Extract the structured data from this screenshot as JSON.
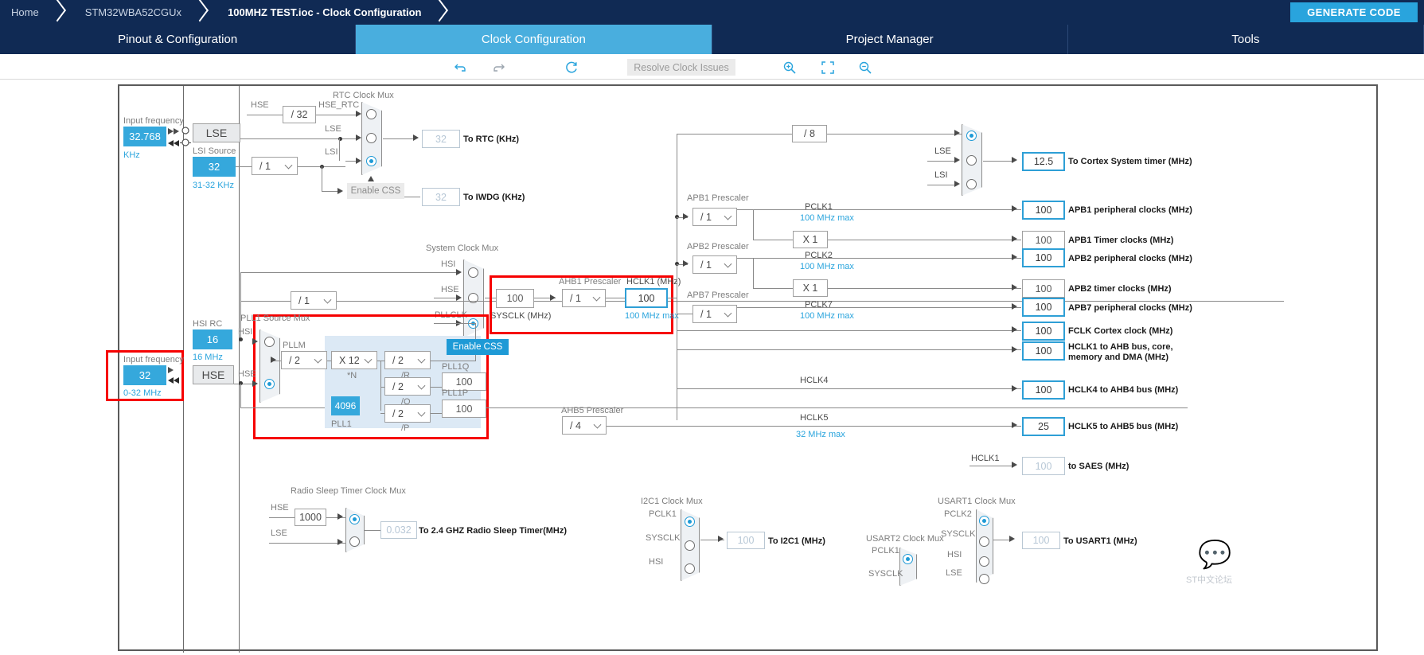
{
  "breadcrumb": {
    "items": [
      {
        "label": "Home",
        "active": false
      },
      {
        "label": "STM32WBA52CGUx",
        "active": false
      },
      {
        "label": "100MHZ TEST.ioc - Clock Configuration",
        "active": true
      }
    ],
    "generate_code_label": "GENERATE CODE"
  },
  "tabs": [
    {
      "label": "Pinout & Configuration",
      "selected": false
    },
    {
      "label": "Clock Configuration",
      "selected": true
    },
    {
      "label": "Project Manager",
      "selected": false
    },
    {
      "label": "Tools",
      "selected": false
    }
  ],
  "toolbar": {
    "undo_icon": "undo-icon",
    "redo_icon": "redo-icon",
    "reset_icon": "reset-icon",
    "resolve_label": "Resolve Clock Issues",
    "zoom_in_icon": "zoom-in-icon",
    "fit_icon": "fit-to-screen-icon",
    "zoom_out_icon": "zoom-out-icon"
  },
  "colors": {
    "accent": "#29a4dd",
    "navy": "#102a54",
    "highlight": "#f60000",
    "cyan_fill": "#35a8dc",
    "pll_panel": "#dce9f5"
  },
  "diagram": {
    "lse_input": {
      "caption": "Input frequency",
      "value": "32.768",
      "unit": "KHz",
      "mux_label": "LSE"
    },
    "lsi": {
      "caption": "LSI Source",
      "value": "32",
      "range": "31-32 KHz",
      "divider": "/ 1"
    },
    "hse_input": {
      "caption": "Input frequency",
      "value": "32",
      "range": "0-32 MHz",
      "mux_label": "HSE"
    },
    "hsi_rc": {
      "caption": "HSI RC",
      "value": "16",
      "range": "16 MHz"
    },
    "hse_div32": {
      "in_label": "HSE",
      "divider": "/ 32",
      "out_label": "HSE_RTC"
    },
    "rtc_mux": {
      "title": "RTC Clock Mux",
      "inputs": [
        "HSE_RTC",
        "LSE",
        "LSI"
      ],
      "selected_index": 2,
      "output_value": "32",
      "output_label": "To RTC (KHz)"
    },
    "css": {
      "label": "Enable CSS",
      "iwdg_value": "32",
      "iwdg_label": "To IWDG (KHz)"
    },
    "sysclk_mux": {
      "title": "System Clock Mux",
      "inputs": [
        "HSI",
        "HSE",
        "PLLCLK"
      ],
      "selected_index": 2,
      "hsi_divider": "/ 1"
    },
    "pll_source_mux": {
      "title": "PLL1 Source Mux",
      "inputs": [
        "HSI",
        "HSE"
      ],
      "selected_index": 1
    },
    "pll1": {
      "name": "PLL1",
      "pllm_label": "PLLM",
      "pllm": "/ 2",
      "plln_label": "*N",
      "plln": "X 12",
      "pllr_label": "/R",
      "pllr": "/ 2",
      "pllq_label": "/Q",
      "pllq": "/ 2",
      "pllp_label": "/P",
      "pllp": "/ 2",
      "fracn": "4096",
      "fracn_label": "PLL1",
      "pll1q_label": "PLL1Q",
      "pll1q_value": "100",
      "pll1p_label": "PLL1P",
      "pll1p_value": "100"
    },
    "css_sysclk": {
      "label": "Enable CSS"
    },
    "sysclk": {
      "value": "100",
      "label": "SYSCLK (MHz)"
    },
    "ahb1_prescaler": {
      "title": "AHB1 Prescaler",
      "value": "/ 1",
      "out_label": "HCLK1 (MHz)",
      "out_value": "100",
      "out_max": "100 MHz max"
    },
    "cortex_div8": "/ 8",
    "cortex_mux": {
      "inputs": [
        "",
        "LSE",
        "LSI"
      ],
      "selected_index": 0,
      "out_value": "12.5",
      "out_label": "To Cortex System timer (MHz)"
    },
    "apb1": {
      "title": "APB1 Prescaler",
      "value": "/ 1",
      "clk_label": "PCLK1",
      "clk_max": "100 MHz max",
      "timer_mult": "X 1",
      "periph_value": "100",
      "periph_label": "APB1 peripheral clocks (MHz)",
      "timer_value": "100",
      "timer_label": "APB1 Timer clocks (MHz)"
    },
    "apb2": {
      "title": "APB2 Prescaler",
      "value": "/ 1",
      "clk_label": "PCLK2",
      "clk_max": "100 MHz max",
      "timer_mult": "X 1",
      "periph_value": "100",
      "periph_label": "APB2 peripheral clocks (MHz)",
      "timer_value": "100",
      "timer_label": "APB2 timer clocks (MHz)"
    },
    "apb7": {
      "title": "APB7 Prescaler",
      "value": "/ 1",
      "clk_label": "PCLK7",
      "clk_max": "100 MHz max",
      "periph_value": "100",
      "periph_label": "APB7 peripheral clocks (MHz)"
    },
    "fclk": {
      "value": "100",
      "label": "FCLK Cortex clock (MHz)"
    },
    "hclk1": {
      "value": "100",
      "label_line1": "HCLK1 to AHB bus, core,",
      "label_line2": "memory and DMA (MHz)"
    },
    "hclk4": {
      "bus_label": "HCLK4",
      "value": "100",
      "label": "HCLK4 to AHB4 bus (MHz)"
    },
    "ahb5_prescaler": {
      "title": "AHB5 Prescaler",
      "value": "/ 4",
      "bus_label": "HCLK5",
      "bus_max": "32 MHz max",
      "value_out": "25",
      "label": "HCLK5 to AHB5 bus (MHz)"
    },
    "saes": {
      "src_label": "HCLK1",
      "value": "100",
      "label": "to SAES (MHz)"
    },
    "radio_sleep": {
      "title": "Radio Sleep Timer Clock Mux",
      "hse_label": "HSE",
      "hse_div": "1000",
      "lse_label": "LSE",
      "selected_index": 0,
      "value": "0.032",
      "label": "To 2.4 GHZ Radio Sleep Timer(MHz)"
    },
    "i2c1": {
      "title": "I2C1 Clock Mux",
      "inputs": [
        "PCLK1",
        "SYSCLK",
        "HSI"
      ],
      "selected_index": 0,
      "value": "100",
      "label": "To I2C1 (MHz)"
    },
    "usart2": {
      "title": "USART2 Clock Mux",
      "inputs": [
        "PCLK1",
        "SYSCLK"
      ],
      "selected_index": 0
    },
    "usart1": {
      "title": "USART1 Clock Mux",
      "inputs": [
        "PCLK2",
        "SYSCLK",
        "HSI",
        "LSE"
      ],
      "selected_index": 0,
      "value": "100",
      "label": "To USART1 (MHz)"
    }
  },
  "watermark": {
    "text": "ST中文论坛"
  }
}
